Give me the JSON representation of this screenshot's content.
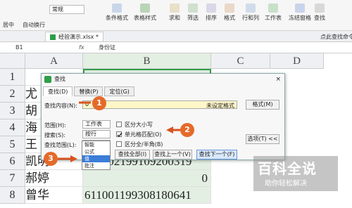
{
  "ribbon": {
    "left_labels": [
      "居中",
      "自动换行"
    ],
    "number_format": "常规",
    "buttons": [
      "条件格式",
      "表格样式",
      "求和",
      "筛选",
      "排序",
      "格式",
      "行和列",
      "工作表",
      "冻结窗格",
      "查找"
    ],
    "search_placeholder": "点此查找命令"
  },
  "file_tab": {
    "label": "经验演示.xlsx *"
  },
  "formula_bar": {
    "name_box": "B1",
    "fx": "fx",
    "value": "身份证"
  },
  "columns": [
    "A",
    "B",
    "C",
    "D"
  ],
  "rows": [
    {
      "num": "1",
      "a": "",
      "b": ""
    },
    {
      "num": "2",
      "a": "尤",
      "b": ""
    },
    {
      "num": "3",
      "a": "胡",
      "b": ""
    },
    {
      "num": "4",
      "a": "海",
      "b": ""
    },
    {
      "num": "5",
      "a": "王",
      "b": ""
    },
    {
      "num": "6",
      "a": "凯明",
      "b": "611002199109200319"
    },
    {
      "num": "7",
      "a": "郝婷",
      "b": "0"
    },
    {
      "num": "8",
      "a": "曾华",
      "b": "611001199308180641"
    }
  ],
  "dialog": {
    "title": "查找",
    "close": "×",
    "tabs": [
      "查找(D)",
      "替换(P)",
      "定位(G)"
    ],
    "find_label": "查找内容(N):",
    "find_value": "0",
    "format_unset": "未设定格式",
    "format_btn": "格式(M)",
    "scope_label": "范围(H):",
    "scope_value": "工作表",
    "search_label": "搜索(S):",
    "search_value": "按行",
    "lookin_label": "查找范围(L):",
    "lookin_value": "值",
    "match_case": "区分大小写",
    "match_cell": "单元格匹配(O)",
    "match_width": "区分全/半角(B)",
    "options_btn": "选项(T) <<",
    "find_all": "查找全部(I)",
    "find_prev": "查找上一个(V)",
    "find_next": "查找下一个(F)",
    "dropdown": [
      "智能",
      "公式",
      "值",
      "批注"
    ]
  },
  "annotations": [
    "1",
    "2",
    "3"
  ],
  "watermark": {
    "main": "百科全说",
    "sub": "助你轻松解决"
  },
  "colors": {
    "accent": "#2e9e48",
    "badge": "#e56a2a",
    "arrow": "#d9531e"
  }
}
